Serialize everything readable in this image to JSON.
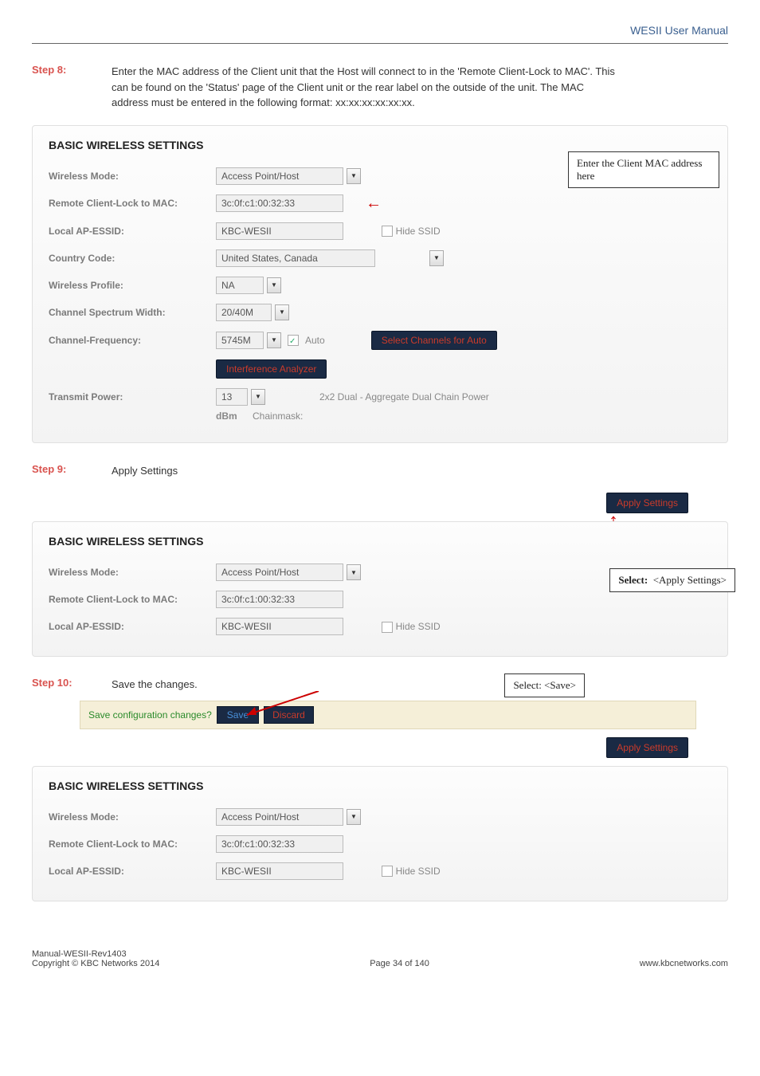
{
  "header": {
    "manual_title": "WESII User Manual"
  },
  "step8": {
    "label": "Step 8:",
    "text": "Enter the MAC address of the Client unit that the Host will connect to in the 'Remote Client-Lock to MAC'. This can be found on the 'Status' page of the Client unit or the rear label on the outside of the unit. The MAC address must be entered in the following format: xx:xx:xx:xx:xx:xx."
  },
  "panel1": {
    "title": "BASIC WIRELESS SETTINGS",
    "wireless_mode_label": "Wireless Mode:",
    "wireless_mode_value": "Access Point/Host",
    "remote_lock_label": "Remote Client-Lock to MAC:",
    "remote_lock_value": "3c:0f:c1:00:32:33",
    "local_essid_label": "Local AP-ESSID:",
    "local_essid_value": "KBC-WESII",
    "hide_ssid_label": "Hide SSID",
    "country_label": "Country Code:",
    "country_value": "United States, Canada",
    "profile_label": "Wireless Profile:",
    "profile_value": "NA",
    "spectrum_label": "Channel Spectrum Width:",
    "spectrum_value": "20/40M",
    "freq_label": "Channel-Frequency:",
    "freq_value": "5745M",
    "auto_label": "Auto",
    "select_channels_btn": "Select Channels for Auto",
    "interference_btn": "Interference Analyzer",
    "transmit_label": "Transmit Power:",
    "transmit_value": "13",
    "dbm_label": "dBm",
    "chainmask_label": "Chainmask:",
    "chain_power_text": "2x2 Dual - Aggregate Dual Chain Power",
    "annotation_text": "Enter the Client MAC address here"
  },
  "step9": {
    "label": "Step 9:",
    "text": "Apply Settings"
  },
  "panel2top": {
    "apply_btn": "Apply Settings"
  },
  "panel2": {
    "title": "BASIC WIRELESS SETTINGS",
    "wireless_mode_label": "Wireless Mode:",
    "wireless_mode_value": "Access Point/Host",
    "remote_lock_label": "Remote Client-Lock to MAC:",
    "remote_lock_value": "3c:0f:c1:00:32:33",
    "local_essid_label": "Local AP-ESSID:",
    "local_essid_value": "KBC-WESII",
    "hide_ssid_label": "Hide SSID",
    "annotation_text": "Select:  <Apply Settings>"
  },
  "step10": {
    "label": "Step 10:",
    "text": "Save the changes.",
    "annotation_text": "Select:  <Save>"
  },
  "savebar": {
    "prompt": "Save configuration changes?",
    "save_btn": "Save",
    "discard_btn": "Discard"
  },
  "panel3top": {
    "apply_btn": "Apply Settings"
  },
  "panel3": {
    "title": "BASIC WIRELESS SETTINGS",
    "wireless_mode_label": "Wireless Mode:",
    "wireless_mode_value": "Access Point/Host",
    "remote_lock_label": "Remote Client-Lock to MAC:",
    "remote_lock_value": "3c:0f:c1:00:32:33",
    "local_essid_label": "Local AP-ESSID:",
    "local_essid_value": "KBC-WESII",
    "hide_ssid_label": "Hide SSID"
  },
  "footer": {
    "left1": "Manual-WESII-Rev1403",
    "left2": "Copyright © KBC Networks 2014",
    "center": "Page 34 of 140",
    "right": "www.kbcnetworks.com"
  }
}
